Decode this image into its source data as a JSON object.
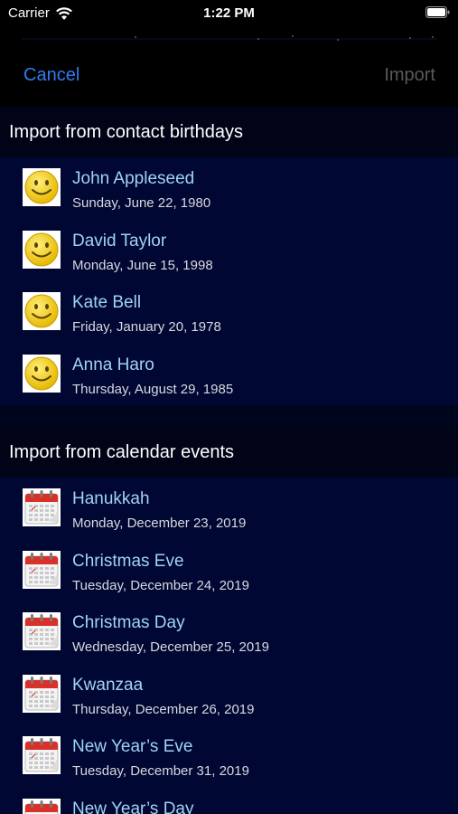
{
  "status_bar": {
    "carrier": "Carrier",
    "time": "1:22 PM",
    "icons": [
      "wifi-icon",
      "battery-icon"
    ]
  },
  "nav": {
    "cancel_label": "Cancel",
    "import_label": "Import"
  },
  "colors": {
    "accent": "#2f7df0",
    "disabled": "#5a5a5a",
    "background": "#000732",
    "title_text": "#9fd3f5"
  },
  "sections": [
    {
      "title": "Import from contact birthdays",
      "icon": "smiley-icon",
      "rows": [
        {
          "name": "John Appleseed",
          "date": "Sunday, June 22, 1980"
        },
        {
          "name": "David Taylor",
          "date": "Monday, June 15, 1998"
        },
        {
          "name": "Kate Bell",
          "date": "Friday, January 20, 1978"
        },
        {
          "name": "Anna Haro",
          "date": "Thursday, August 29, 1985"
        }
      ]
    },
    {
      "title": "Import from calendar events",
      "icon": "calendar-icon",
      "rows": [
        {
          "name": "Hanukkah",
          "date": "Monday, December 23, 2019"
        },
        {
          "name": "Christmas Eve",
          "date": "Tuesday, December 24, 2019"
        },
        {
          "name": "Christmas Day",
          "date": "Wednesday, December 25, 2019"
        },
        {
          "name": "Kwanzaa",
          "date": "Thursday, December 26, 2019"
        },
        {
          "name": "New Year’s Eve",
          "date": "Tuesday, December 31, 2019"
        },
        {
          "name": "New Year’s Day",
          "date": ""
        }
      ]
    }
  ]
}
